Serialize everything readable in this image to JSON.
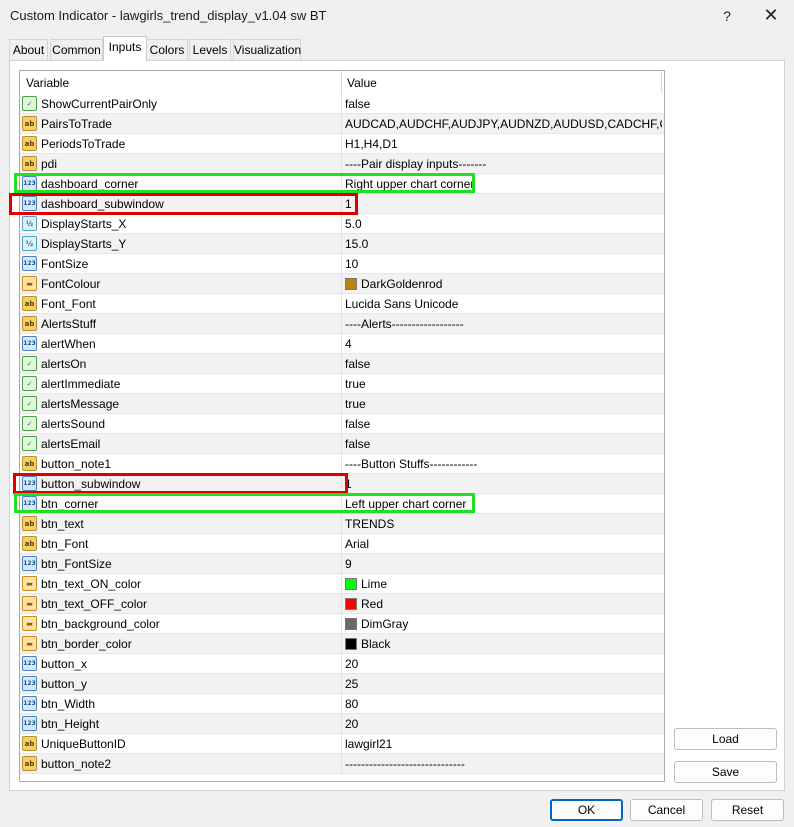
{
  "window": {
    "title": "Custom Indicator - lawgirls_trend_display_v1.04 sw BT",
    "help_label": "?",
    "close_label": "✕"
  },
  "tabs": [
    {
      "label": "About",
      "active": false
    },
    {
      "label": "Common",
      "active": false
    },
    {
      "label": "Inputs",
      "active": true
    },
    {
      "label": "Colors",
      "active": false
    },
    {
      "label": "Levels",
      "active": false
    },
    {
      "label": "Visualization",
      "active": false
    }
  ],
  "grid": {
    "headers": {
      "variable": "Variable",
      "value": "Value"
    },
    "rows": [
      {
        "icon": "bool",
        "name": "ShowCurrentPairOnly",
        "value": "false"
      },
      {
        "icon": "ab",
        "name": "PairsToTrade",
        "value": "AUDCAD,AUDCHF,AUDJPY,AUDNZD,AUDUSD,CADCHF,CAD..."
      },
      {
        "icon": "ab",
        "name": "PeriodsToTrade",
        "value": "H1,H4,D1"
      },
      {
        "icon": "ab",
        "name": "pdi",
        "value": "----Pair display inputs-------"
      },
      {
        "icon": "num",
        "name": "dashboard_corner",
        "value": "Right upper chart corner"
      },
      {
        "icon": "num",
        "name": "dashboard_subwindow",
        "value": "1"
      },
      {
        "icon": "dbl",
        "name": "DisplayStarts_X",
        "value": "5.0"
      },
      {
        "icon": "dbl",
        "name": "DisplayStarts_Y",
        "value": "15.0"
      },
      {
        "icon": "num",
        "name": "FontSize",
        "value": "10"
      },
      {
        "icon": "clr",
        "name": "FontColour",
        "value": "DarkGoldenrod",
        "swatch": "#b8860b"
      },
      {
        "icon": "ab",
        "name": "Font_Font",
        "value": "Lucida Sans Unicode"
      },
      {
        "icon": "ab",
        "name": "AlertsStuff",
        "value": "----Alerts------------------"
      },
      {
        "icon": "num",
        "name": "alertWhen",
        "value": "4"
      },
      {
        "icon": "bool",
        "name": "alertsOn",
        "value": "false"
      },
      {
        "icon": "bool",
        "name": "alertImmediate",
        "value": "true"
      },
      {
        "icon": "bool",
        "name": "alertsMessage",
        "value": "true"
      },
      {
        "icon": "bool",
        "name": "alertsSound",
        "value": "false"
      },
      {
        "icon": "bool",
        "name": "alertsEmail",
        "value": "false"
      },
      {
        "icon": "ab",
        "name": "button_note1",
        "value": "----Button Stuffs------------"
      },
      {
        "icon": "num",
        "name": "button_subwindow",
        "value": "1"
      },
      {
        "icon": "num",
        "name": "btn_corner",
        "value": "Left upper chart corner"
      },
      {
        "icon": "ab",
        "name": "btn_text",
        "value": "TRENDS"
      },
      {
        "icon": "ab",
        "name": "btn_Font",
        "value": "Arial"
      },
      {
        "icon": "num",
        "name": "btn_FontSize",
        "value": "9"
      },
      {
        "icon": "clr",
        "name": "btn_text_ON_color",
        "value": "Lime",
        "swatch": "#00ff00"
      },
      {
        "icon": "clr",
        "name": "btn_text_OFF_color",
        "value": "Red",
        "swatch": "#ff0000"
      },
      {
        "icon": "clr",
        "name": "btn_background_color",
        "value": "DimGray",
        "swatch": "#696969"
      },
      {
        "icon": "clr",
        "name": "btn_border_color",
        "value": "Black",
        "swatch": "#000000"
      },
      {
        "icon": "num",
        "name": "button_x",
        "value": "20"
      },
      {
        "icon": "num",
        "name": "button_y",
        "value": "25"
      },
      {
        "icon": "num",
        "name": "btn_Width",
        "value": "80"
      },
      {
        "icon": "num",
        "name": "btn_Height",
        "value": "20"
      },
      {
        "icon": "ab",
        "name": "UniqueButtonID",
        "value": "lawgirl21"
      },
      {
        "icon": "ab",
        "name": "button_note2",
        "value": "------------------------------"
      }
    ]
  },
  "icon_glyphs": {
    "ab": "ab",
    "num": "123",
    "dbl": "½",
    "bool": "✓",
    "clr": "▬"
  },
  "side_buttons": {
    "load": "Load",
    "save": "Save"
  },
  "footer": {
    "ok": "OK",
    "cancel": "Cancel",
    "reset": "Reset"
  },
  "highlight_colors": {
    "green": "#20e020",
    "red": "#e00000"
  }
}
